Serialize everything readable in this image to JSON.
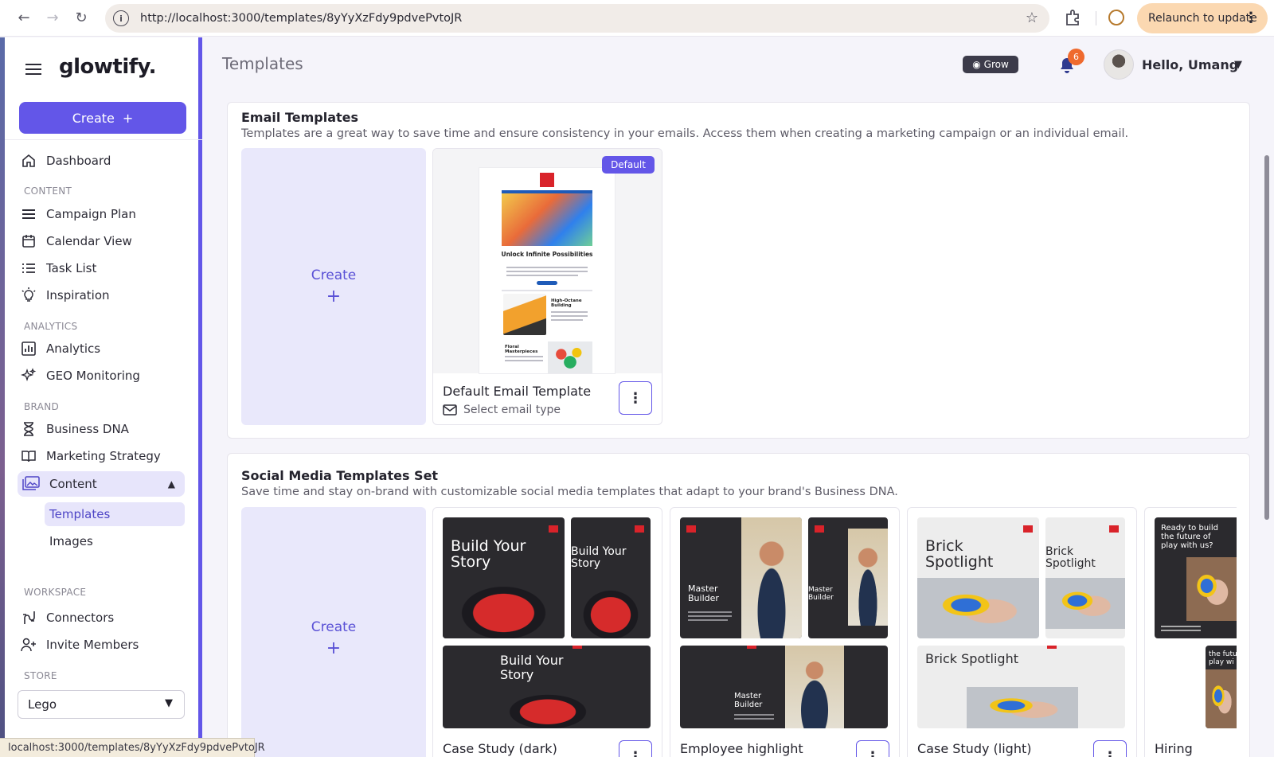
{
  "browser": {
    "url": "http://localhost:3000/templates/8yYyXzFdy9pdvePvtoJR",
    "relaunch_label": "Relaunch to update",
    "status_url": "localhost:3000/templates/8yYyXzFdy9pdvePvtoJR"
  },
  "sidebar": {
    "logo": "glowtify.",
    "create_label": "Create",
    "dashboard": "Dashboard",
    "section_content": "CONTENT",
    "campaign_plan": "Campaign Plan",
    "calendar_view": "Calendar View",
    "task_list": "Task List",
    "inspiration": "Inspiration",
    "section_analytics": "ANALYTICS",
    "analytics": "Analytics",
    "geo_monitoring": "GEO Monitoring",
    "section_brand": "BRAND",
    "business_dna": "Business DNA",
    "marketing_strategy": "Marketing Strategy",
    "content": "Content",
    "templates": "Templates",
    "images": "Images",
    "section_workspace": "WORKSPACE",
    "connectors": "Connectors",
    "invite_members": "Invite Members",
    "section_store": "STORE",
    "store_value": "Lego"
  },
  "header": {
    "title": "Templates",
    "grow_label": "Grow",
    "notification_count": "6",
    "greeting": "Hello, Umang"
  },
  "email_section": {
    "title": "Email Templates",
    "description": "Templates are a great way to save time and ensure consistency in your emails. Access them when creating a marketing campaign or an individual email.",
    "create_label": "Create",
    "create_plus": "+",
    "card": {
      "badge": "Default",
      "name": "Default Email Template",
      "type_label": "Select email type",
      "preview_heading": "Unlock Infinite Possibilities",
      "preview_sub1": "High-Octane Building",
      "preview_sub2": "Floral Masterpieces"
    }
  },
  "social_section": {
    "title": "Social Media Templates Set",
    "description": "Save time and stay on-brand with customizable social media templates that adapt to your brand's Business DNA.",
    "create_label": "Create",
    "create_plus": "+",
    "cards": [
      {
        "name": "Case Study (dark)",
        "headline": "Build Your Story"
      },
      {
        "name": "Employee highlight",
        "headline": "Master Builder"
      },
      {
        "name": "Case Study (light)",
        "headline": "Brick Spotlight"
      },
      {
        "name": "Hiring",
        "headline": "Ready to build the future of play with us?",
        "headline_short": "the futu play wi"
      }
    ]
  },
  "colors": {
    "accent": "#6356e8",
    "create_tile_bg": "#e9e8fb",
    "notification_badge": "#ef6a2e"
  }
}
